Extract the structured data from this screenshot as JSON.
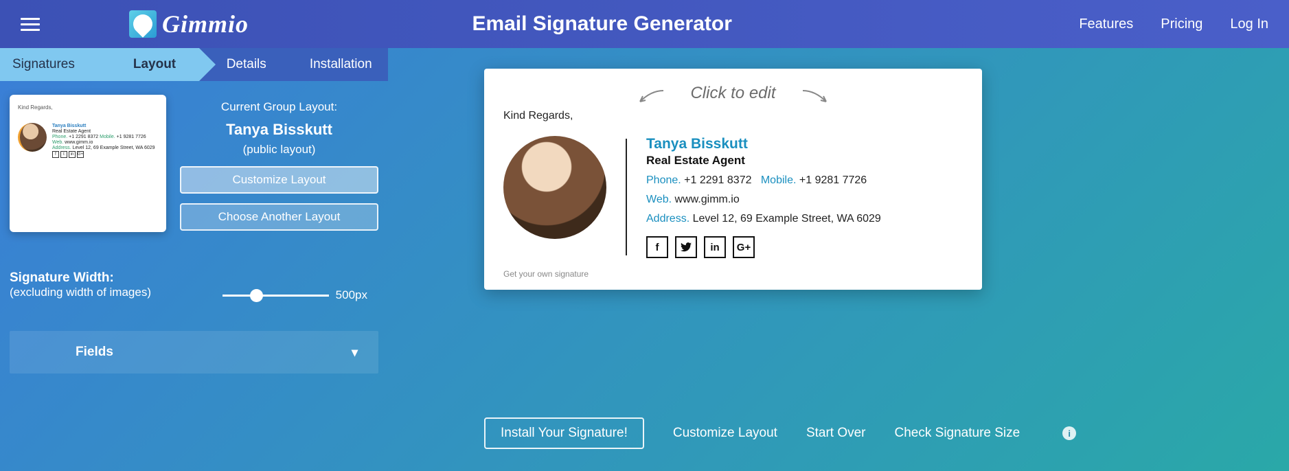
{
  "header": {
    "brand": "Gimmio",
    "title": "Email Signature Generator",
    "nav": {
      "features": "Features",
      "pricing": "Pricing",
      "login": "Log In"
    }
  },
  "tabs": {
    "signatures": "Signatures",
    "layout": "Layout",
    "details": "Details",
    "installation": "Installation"
  },
  "group": {
    "label": "Current Group Layout:",
    "name": "Tanya Bisskutt",
    "public": "(public layout)",
    "customize": "Customize Layout",
    "choose": "Choose Another Layout"
  },
  "thumb": {
    "greeting": "Kind Regards,",
    "name": "Tanya Bisskutt",
    "role": "Real Estate Agent",
    "phone_lab": "Phone.",
    "phone": "+1 2291 8372",
    "mobile_lab": "Mobile.",
    "mobile": "+1 9281 7726",
    "web_lab": "Web.",
    "web": "www.gimm.io",
    "addr_lab": "Address.",
    "addr": "Level 12, 69 Example Street, WA 6029",
    "f": "f",
    "t": "t",
    "in": "in",
    "g": "G+"
  },
  "width": {
    "title": "Signature Width:",
    "subtitle": "(excluding width of images)",
    "value": "500px"
  },
  "fields": {
    "label": "Fields"
  },
  "preview": {
    "cte": "Click to edit",
    "greeting": "Kind Regards,",
    "name": "Tanya Bisskutt",
    "role": "Real Estate Agent",
    "phone_lab": "Phone.",
    "phone": "+1 2291 8372",
    "mobile_lab": "Mobile.",
    "mobile": "+1 9281 7726",
    "web_lab": "Web.",
    "web": "www.gimm.io",
    "addr_lab": "Address.",
    "addr": "Level 12, 69 Example Street, WA 6029",
    "social": {
      "f": "f",
      "t": "t",
      "in": "in",
      "g": "G+"
    },
    "getown": "Get your own signature"
  },
  "actions": {
    "install": "Install Your Signature!",
    "customize": "Customize Layout",
    "startover": "Start Over",
    "check": "Check Signature Size"
  }
}
